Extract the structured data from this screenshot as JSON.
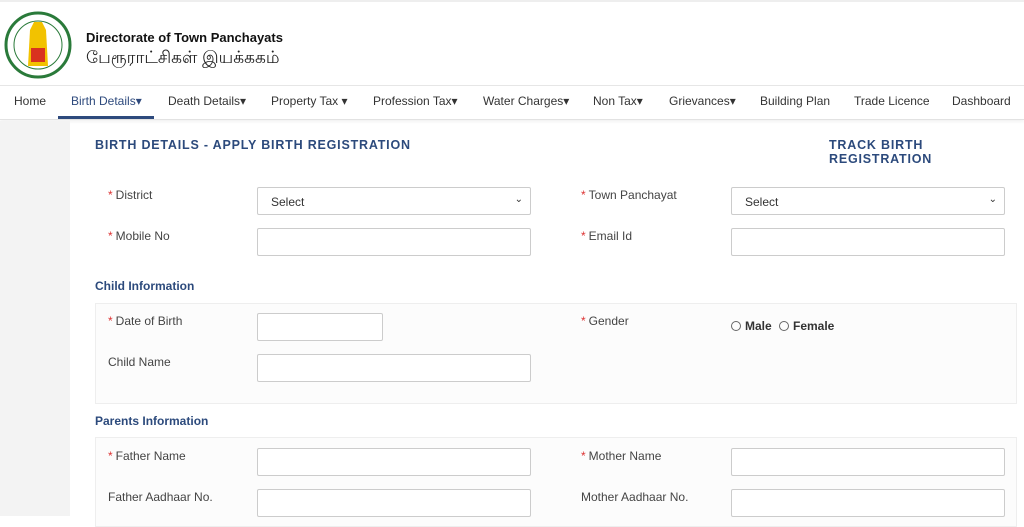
{
  "header": {
    "title": "Directorate of Town Panchayats",
    "title_tamil": "பேரூராட்சிகள் இயக்ககம்"
  },
  "nav": [
    {
      "label": "Home"
    },
    {
      "label": "Birth Details▾",
      "active": true
    },
    {
      "label": "Death Details▾"
    },
    {
      "label": "Property Tax ▾"
    },
    {
      "label": "Profession Tax▾"
    },
    {
      "label": "Water Charges▾"
    },
    {
      "label": "Non Tax▾"
    },
    {
      "label": "Grievances▾"
    },
    {
      "label": "Building Plan"
    },
    {
      "label": "Trade Licence"
    },
    {
      "label": "Dashboard"
    }
  ],
  "page": {
    "heading": "BIRTH DETAILS - APPLY BIRTH REGISTRATION",
    "track_link": "TRACK BIRTH REGISTRATION"
  },
  "form": {
    "required_mark": "*",
    "district": {
      "label": "District",
      "value": "Select"
    },
    "town_panchayat": {
      "label": "Town Panchayat",
      "value": "Select"
    },
    "mobile": {
      "label": "Mobile No",
      "value": ""
    },
    "email": {
      "label": "Email Id",
      "value": ""
    },
    "child_section": "Child Information",
    "dob": {
      "label": "Date of Birth",
      "value": ""
    },
    "gender": {
      "label": "Gender",
      "options": [
        "Male",
        "Female"
      ],
      "selected": null
    },
    "child_name": {
      "label": "Child Name",
      "value": ""
    },
    "parents_section": "Parents Information",
    "father_name": {
      "label": "Father Name",
      "value": ""
    },
    "mother_name": {
      "label": "Mother Name",
      "value": ""
    },
    "father_aadhaar": {
      "label": "Father Aadhaar No.",
      "value": ""
    },
    "mother_aadhaar": {
      "label": "Mother Aadhaar No.",
      "value": ""
    }
  },
  "colors": {
    "accent": "#2c4a7c",
    "required": "#dd3333"
  }
}
